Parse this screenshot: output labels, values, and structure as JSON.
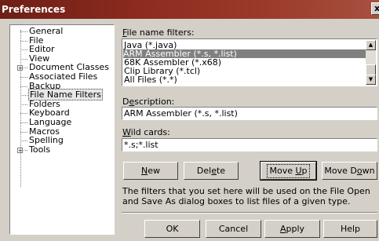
{
  "window": {
    "title": "Preferences",
    "close_glyph": "x"
  },
  "tree": {
    "items": [
      {
        "label": "General"
      },
      {
        "label": "File"
      },
      {
        "label": "Editor"
      },
      {
        "label": "View"
      },
      {
        "label": "Document Classes",
        "expander": "+"
      },
      {
        "label": "Associated Files"
      },
      {
        "label": "Backup"
      },
      {
        "label": "File Name Filters",
        "selected": true
      },
      {
        "label": "Folders"
      },
      {
        "label": "Keyboard"
      },
      {
        "label": "Language"
      },
      {
        "label": "Macros"
      },
      {
        "label": "Spelling"
      },
      {
        "label": "Tools",
        "expander": "+"
      }
    ]
  },
  "filters": {
    "label_first": "F",
    "label_rest": "ile name filters:",
    "items": [
      "Java (*.java)",
      "ARM Assembler (*.s, *.list)",
      "68K Assembler (*.x68)",
      "Clip Library (*.tcl)",
      "All Files (*.*)"
    ],
    "selected_index": 1
  },
  "description": {
    "label_pre": "D",
    "label_u": "e",
    "label_post": "scription:",
    "value": "ARM Assembler (*.s, *.list)"
  },
  "wildcards": {
    "label_u": "W",
    "label_post": "ild cards:",
    "value": "*.s;*.list"
  },
  "actions": {
    "new": {
      "u": "N",
      "rest": "ew"
    },
    "delete": {
      "pre": "Del",
      "u": "e",
      "post": "te"
    },
    "move_up": {
      "pre": "Move ",
      "u": "U",
      "post": "p"
    },
    "move_down": {
      "pre": "Move D",
      "u": "o",
      "post": "wn"
    }
  },
  "info_text": "The filters that you set here will be used on the File Open and Save As dialog boxes to list files of a given type.",
  "footer": {
    "ok": "OK",
    "cancel": "Cancel",
    "apply_u": "A",
    "apply_rest": "pply",
    "help": "Help"
  }
}
